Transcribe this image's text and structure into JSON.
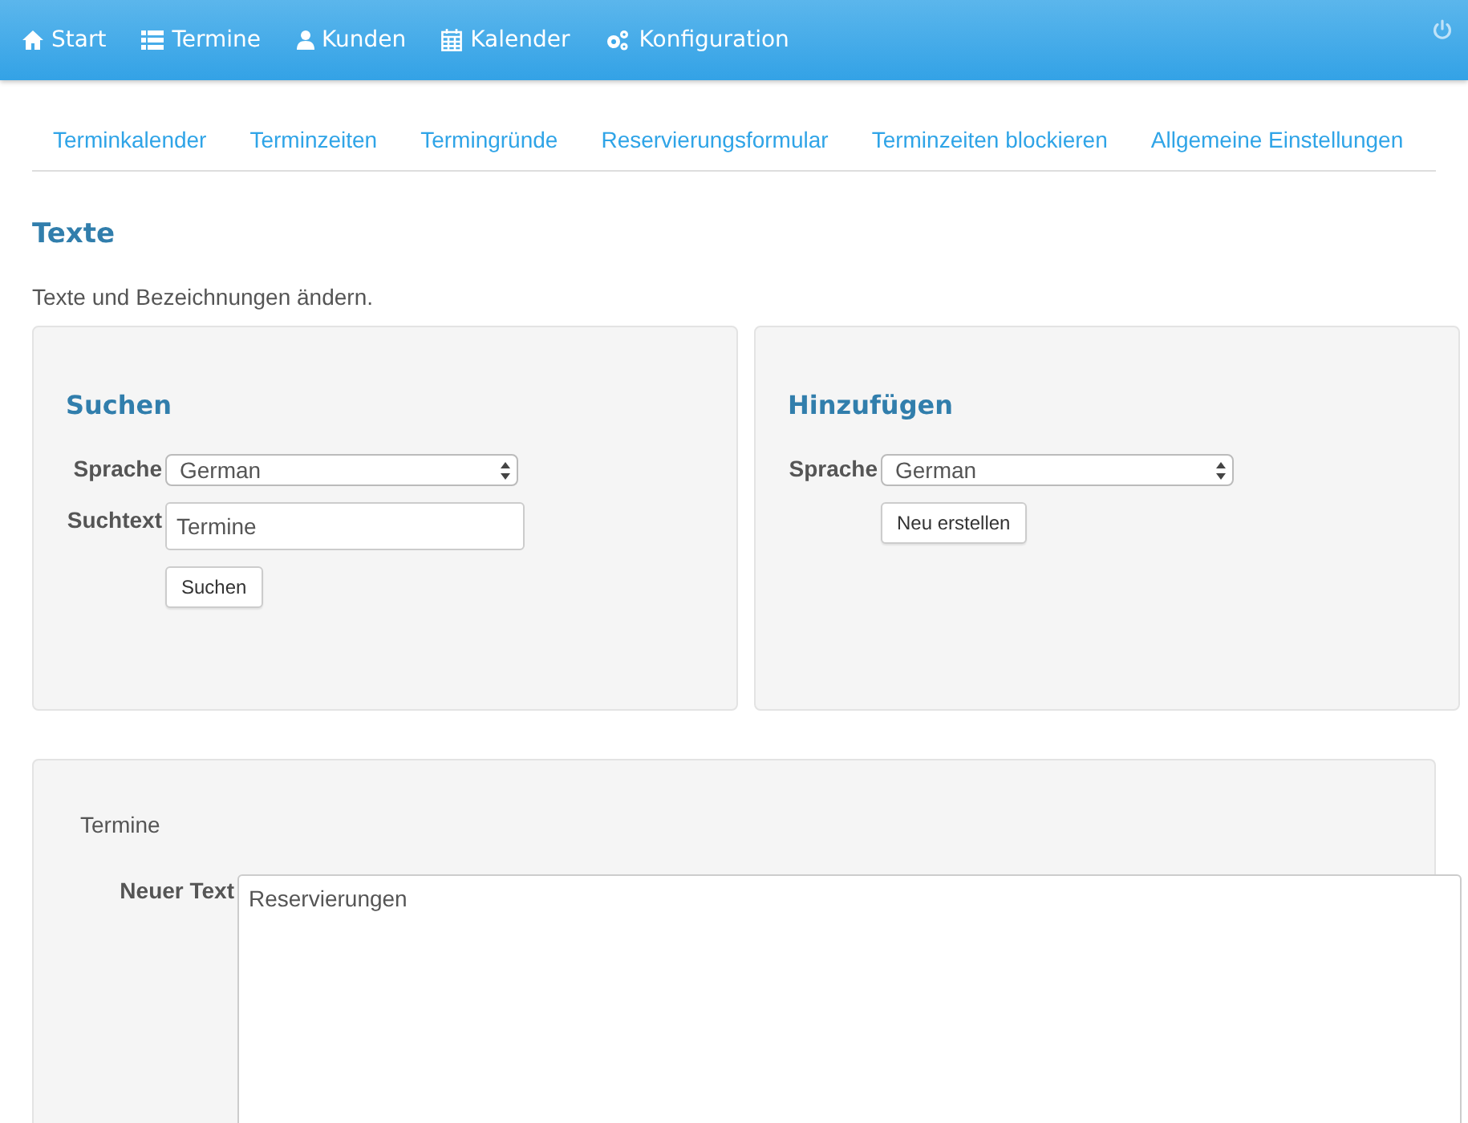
{
  "nav": {
    "items": [
      {
        "label": "Start"
      },
      {
        "label": "Termine"
      },
      {
        "label": "Kunden"
      },
      {
        "label": "Kalender"
      },
      {
        "label": "Konfiguration"
      }
    ]
  },
  "tabs": [
    "Terminkalender",
    "Terminzeiten",
    "Termingründe",
    "Reservierungsformular",
    "Terminzeiten blockieren",
    "Allgemeine Einstellungen"
  ],
  "page": {
    "title": "Texte",
    "description": "Texte und Bezeichnungen ändern."
  },
  "search_panel": {
    "title": "Suchen",
    "language_label": "Sprache",
    "language": "German",
    "text_label": "Suchtext",
    "text": "Termine",
    "button": "Suchen"
  },
  "add_panel": {
    "title": "Hinzufügen",
    "language_label": "Sprache",
    "language": "German",
    "button": "Neu erstellen"
  },
  "edit_panel": {
    "key": "Termine",
    "label": "Neuer Text",
    "value": "Reservierungen"
  }
}
